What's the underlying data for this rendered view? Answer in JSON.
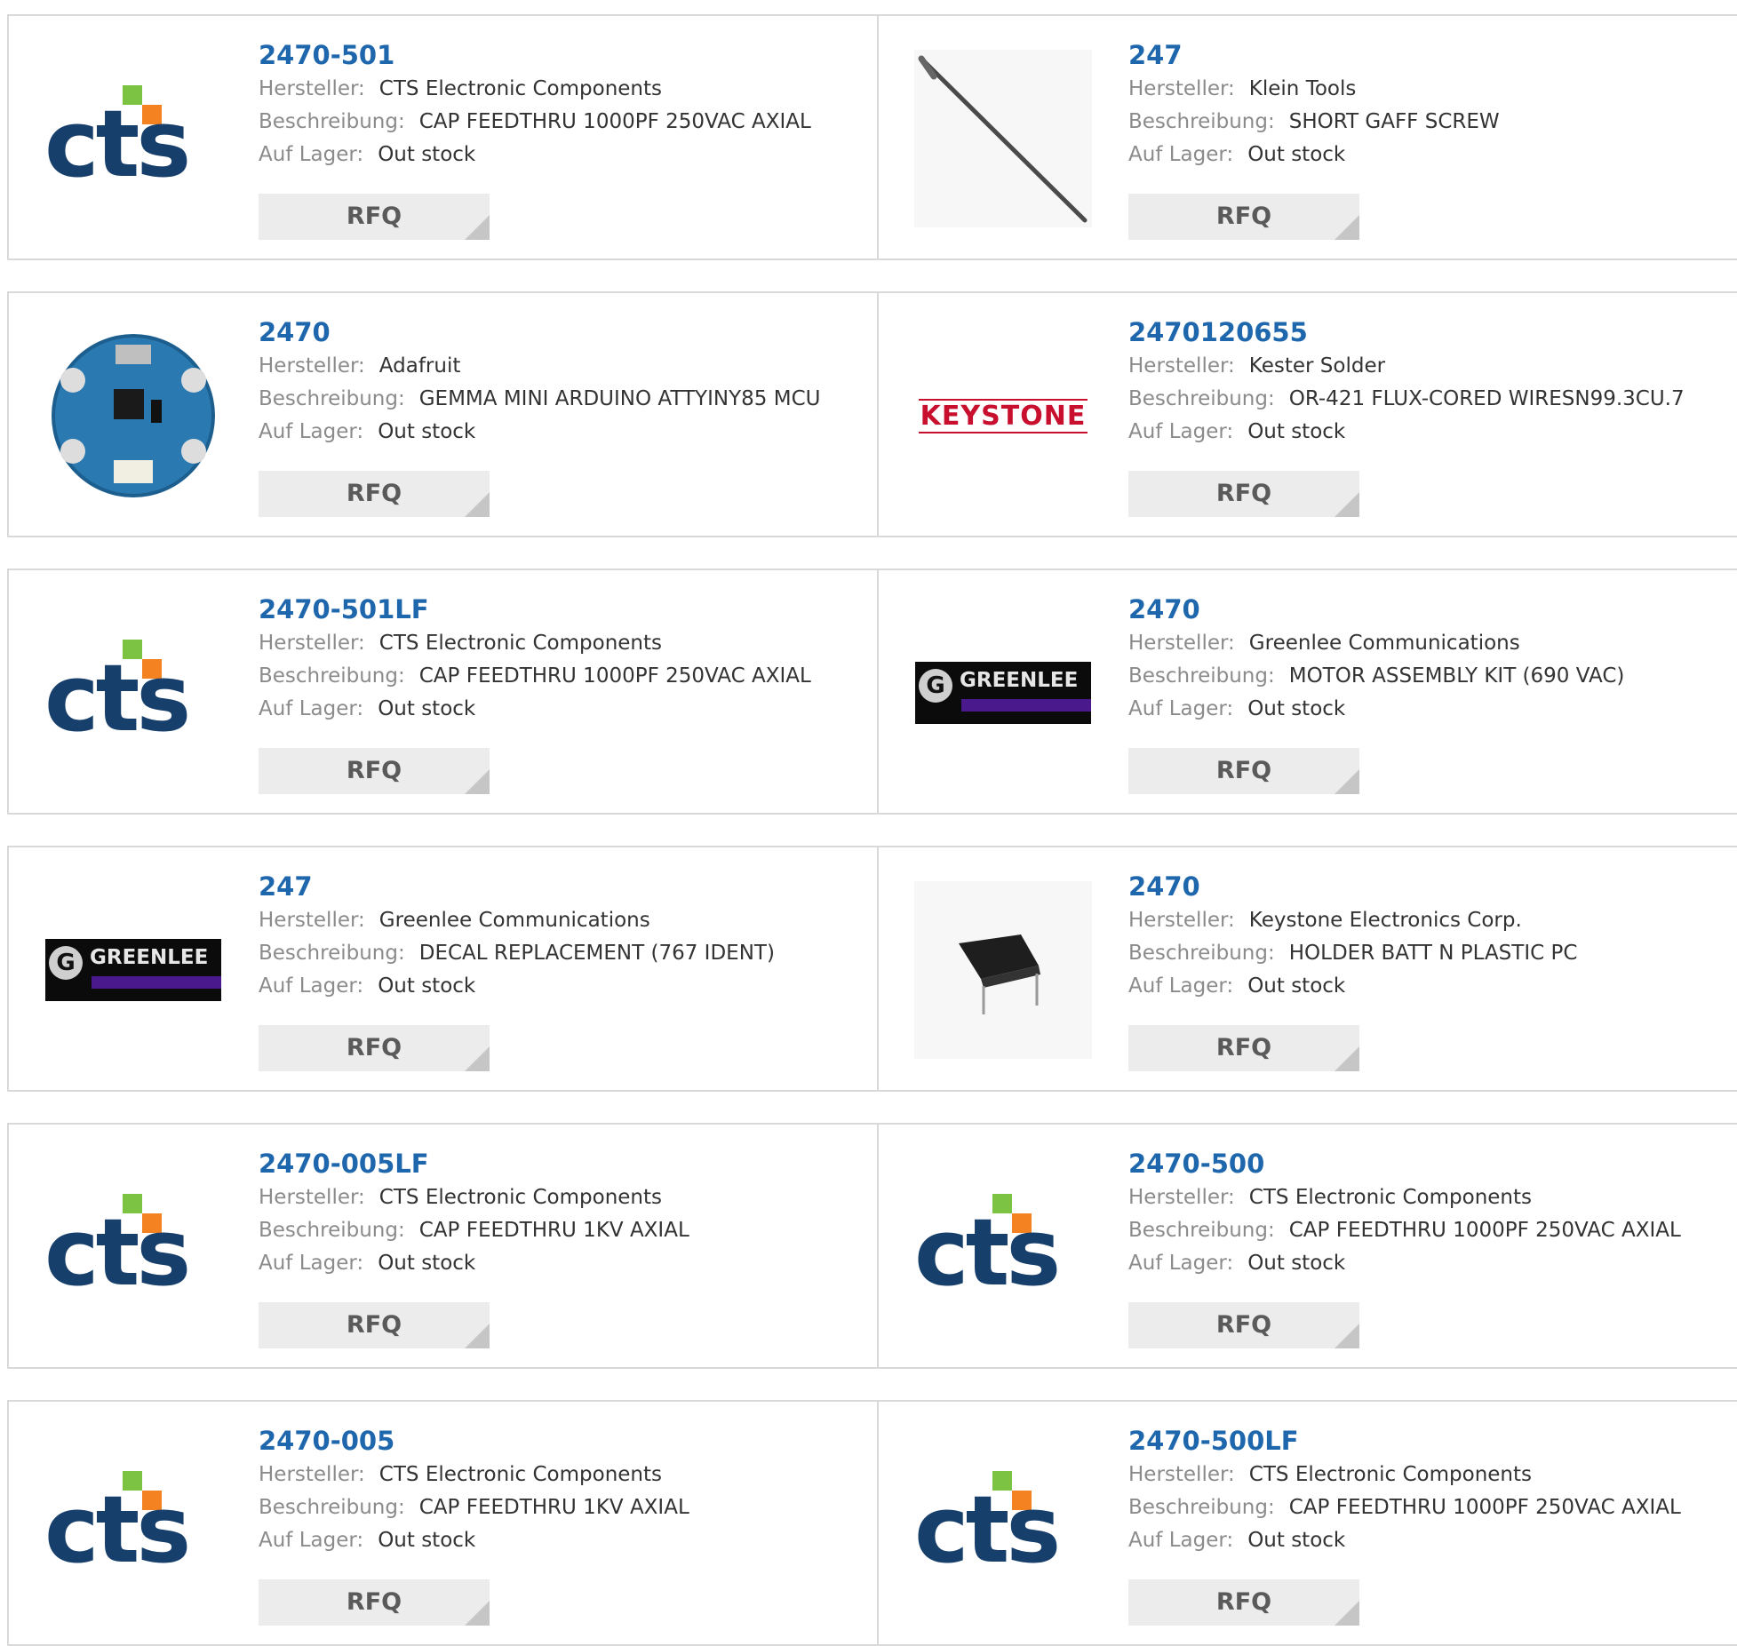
{
  "labels": {
    "manufacturer": "Hersteller:",
    "description": "Beschreibung:",
    "stock": "Auf Lager:",
    "rfq": "RFQ"
  },
  "brand_colors": {
    "part_link": "#1f67ad",
    "cts_blue": "#173f6b",
    "cts_green": "#7cc243",
    "cts_orange": "#f58220",
    "keystone_red": "#c8102e"
  },
  "logos": {
    "cts": "cts",
    "greenlee": "GREENLEE",
    "keystone": "KEYSTONE"
  },
  "products": [
    {
      "part": "2470-501",
      "manufacturer": "CTS Electronic Components",
      "description": "CAP FEEDTHRU 1000PF 250VAC AXIAL",
      "stock": "Out stock",
      "image": "cts-logo"
    },
    {
      "part": "247",
      "manufacturer": "Klein Tools",
      "description": "SHORT GAFF SCREW",
      "stock": "Out stock",
      "image": "gaff-screw-photo"
    },
    {
      "part": "2470",
      "manufacturer": "Adafruit",
      "description": "GEMMA MINI ARDUINO ATTYINY85 MCU",
      "stock": "Out stock",
      "image": "gemma-board-photo"
    },
    {
      "part": "2470120655",
      "manufacturer": "Kester Solder",
      "description": "OR-421 FLUX-CORED WIRESN99.3CU.7",
      "stock": "Out stock",
      "image": "keystone-logo"
    },
    {
      "part": "2470-501LF",
      "manufacturer": "CTS Electronic Components",
      "description": "CAP FEEDTHRU 1000PF 250VAC AXIAL",
      "stock": "Out stock",
      "image": "cts-logo"
    },
    {
      "part": "2470",
      "manufacturer": "Greenlee Communications",
      "description": "MOTOR ASSEMBLY KIT (690 VAC)",
      "stock": "Out stock",
      "image": "greenlee-logo"
    },
    {
      "part": "247",
      "manufacturer": "Greenlee Communications",
      "description": "DECAL REPLACEMENT (767 IDENT)",
      "stock": "Out stock",
      "image": "greenlee-logo"
    },
    {
      "part": "2470",
      "manufacturer": "Keystone Electronics Corp.",
      "description": "HOLDER BATT N PLASTIC PC",
      "stock": "Out stock",
      "image": "battery-holder-photo"
    },
    {
      "part": "2470-005LF",
      "manufacturer": "CTS Electronic Components",
      "description": "CAP FEEDTHRU 1KV AXIAL",
      "stock": "Out stock",
      "image": "cts-logo"
    },
    {
      "part": "2470-500",
      "manufacturer": "CTS Electronic Components",
      "description": "CAP FEEDTHRU 1000PF 250VAC AXIAL",
      "stock": "Out stock",
      "image": "cts-logo"
    },
    {
      "part": "2470-005",
      "manufacturer": "CTS Electronic Components",
      "description": "CAP FEEDTHRU 1KV AXIAL",
      "stock": "Out stock",
      "image": "cts-logo"
    },
    {
      "part": "2470-500LF",
      "manufacturer": "CTS Electronic Components",
      "description": "CAP FEEDTHRU 1000PF 250VAC AXIAL",
      "stock": "Out stock",
      "image": "cts-logo"
    }
  ]
}
